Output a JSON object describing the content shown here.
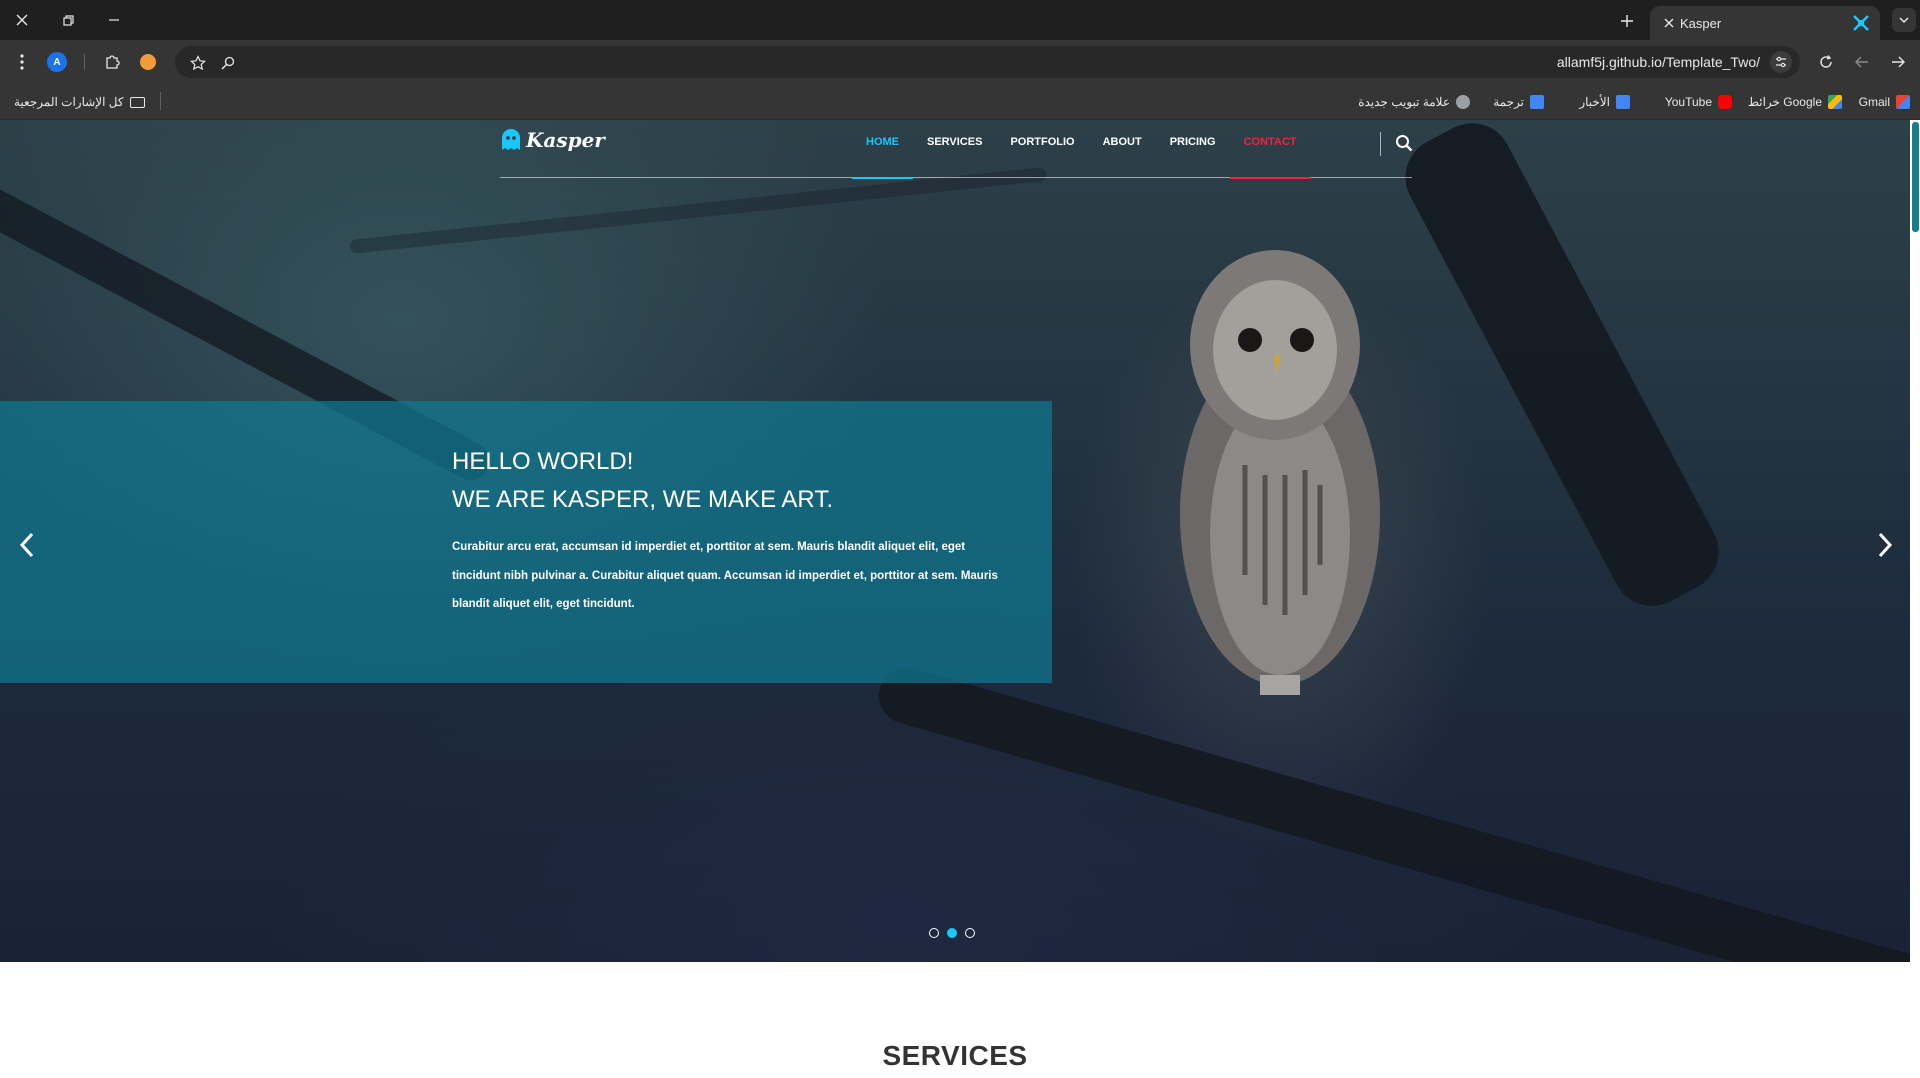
{
  "browser": {
    "tab_title": "Kasper",
    "url": "allamf5j.github.io/Template_Two/",
    "profile_initial": "A",
    "bookmarks": [
      {
        "label": "Gmail",
        "icon": "gmail-icon"
      },
      {
        "label": "Google خرائط",
        "icon": "maps-icon"
      },
      {
        "label": "YouTube",
        "icon": "youtube-icon"
      },
      {
        "label": "الأخبار",
        "icon": "news-icon"
      },
      {
        "label": "ترجمة",
        "icon": "translate-icon"
      },
      {
        "label": "علامة تبويب جديدة",
        "icon": "globe-icon"
      }
    ],
    "all_bookmarks": "كل الإشارات المرجعية"
  },
  "site": {
    "logo_text": "Kasper",
    "nav": [
      "HOME",
      "SERVICES",
      "PORTFOLIO",
      "ABOUT",
      "PRICING",
      "CONTACT"
    ],
    "active_nav": "HOME",
    "hero": {
      "title_line1": "HELLO WORLD!",
      "title_line2": "WE ARE KASPER, WE MAKE ART.",
      "text": "Curabitur arcu erat, accumsan id imperdiet et, porttitor at sem. Mauris blandit aliquet elit, eget tincidunt nibh pulvinar a. Curabitur aliquet quam. Accumsan id imperdiet et, porttitor at sem. Mauris blandit aliquet elit, eget tincidunt.",
      "slides_total": 3,
      "active_slide": 2
    },
    "services_title": "SERVICES"
  },
  "colors": {
    "accent_blue": "#19c8fa",
    "accent_red": "#f7203b",
    "caption_bg": "#0f7891"
  }
}
